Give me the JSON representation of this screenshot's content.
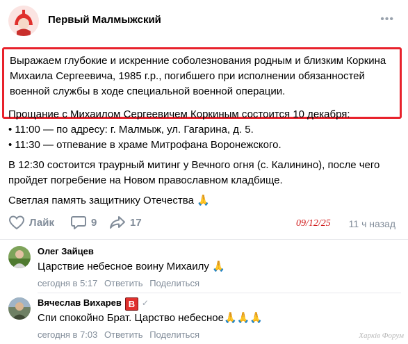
{
  "header": {
    "group_name": "Первый Малмыжский",
    "more_icon": "more-dots-icon"
  },
  "post": {
    "highlighted_text": "Выражаем глубокие и искренние соболезнования родным и близким Коркина Михаила Сергеевича, 1985 г.р., погибшего при исполнении обязанностей военной службы в ходе специальной военной операции.",
    "line_farewell": "Прощание с Михаилом Сергеевичем Коркиным состоится 10 декабря:",
    "line_1100": "• 11:00 — по адресу: г. Малмыж, ул. Гагарина, д. 5.",
    "line_1130": "• 11:30 — отпевание в храме Митрофана Воронежского.",
    "paragraph_rally": "В 12:30 состоится траурный митинг у Вечного огня (с. Калинино), после чего пройдет погребение на Новом православном кладбище.",
    "memory": "Светлая память защитнику Отечества",
    "memory_emoji": "🙏",
    "highlight_color": "#e8212b"
  },
  "actions": {
    "like_label": "Лайк",
    "comments_count": "9",
    "shares_count": "17",
    "handwritten_date": "09/12/25",
    "time_ago": "11 ч назад"
  },
  "comments": [
    {
      "author": "Олег Зайцев",
      "text": "Царствие небесное воину Михаилу",
      "emoji": "🙏",
      "time": "сегодня в 5:17",
      "reply": "Ответить",
      "share": "Поделиться"
    },
    {
      "author": "Вячеслав Вихарев",
      "badge": "В",
      "text": "Спи спокойно Брат. Царство небесное",
      "emoji": "🙏🙏🙏",
      "time": "сегодня в 7:03",
      "reply": "Ответить",
      "share": "Поделиться"
    }
  ],
  "watermark": "Харків Форум"
}
